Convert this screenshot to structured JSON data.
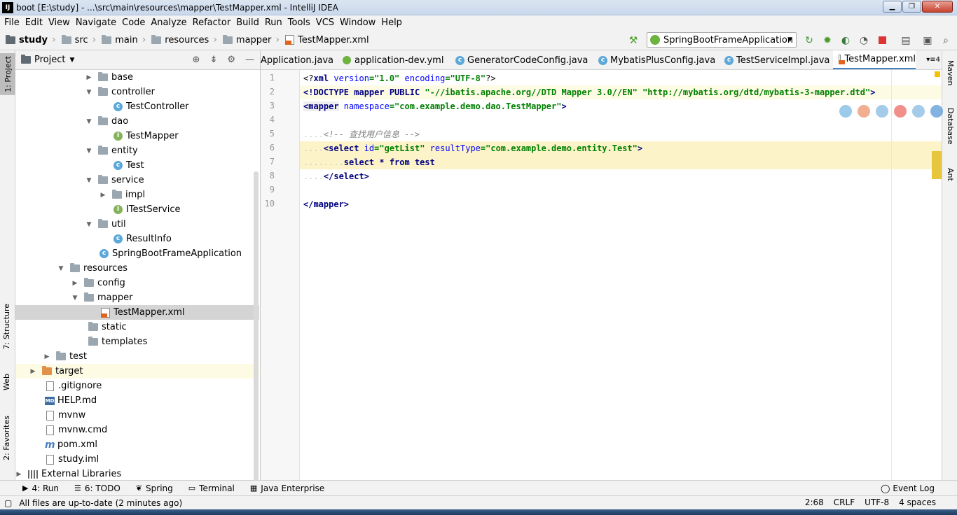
{
  "window": {
    "title": "boot [E:\\study] - ...\\src\\main\\resources\\mapper\\TestMapper.xml - IntelliJ IDEA",
    "app_icon": "IJ"
  },
  "menu": [
    "File",
    "Edit",
    "View",
    "Navigate",
    "Code",
    "Analyze",
    "Refactor",
    "Build",
    "Run",
    "Tools",
    "VCS",
    "Window",
    "Help"
  ],
  "breadcrumbs": [
    "study",
    "src",
    "main",
    "resources",
    "mapper",
    "TestMapper.xml"
  ],
  "run_config": "SpringBootFrameApplication",
  "left_stripe": [
    "1: Project",
    "7: Structure",
    "Web",
    "2: Favorites"
  ],
  "right_stripe": [
    "Maven",
    "Database",
    "Ant"
  ],
  "project_panel": {
    "title": "Project",
    "tree": [
      {
        "label": "base",
        "type": "folder",
        "chev": "right"
      },
      {
        "label": "controller",
        "type": "folder",
        "chev": "down"
      },
      {
        "label": "TestController",
        "type": "class",
        "chev": ""
      },
      {
        "label": "dao",
        "type": "folder",
        "chev": "down"
      },
      {
        "label": "TestMapper",
        "type": "interface",
        "chev": ""
      },
      {
        "label": "entity",
        "type": "folder",
        "chev": "down"
      },
      {
        "label": "Test",
        "type": "class",
        "chev": ""
      },
      {
        "label": "service",
        "type": "folder",
        "chev": "down"
      },
      {
        "label": "impl",
        "type": "folder",
        "chev": "right"
      },
      {
        "label": "ITestService",
        "type": "interface",
        "chev": ""
      },
      {
        "label": "util",
        "type": "folder",
        "chev": "down"
      },
      {
        "label": "ResultInfo",
        "type": "class",
        "chev": ""
      },
      {
        "label": "SpringBootFrameApplication",
        "type": "class",
        "chev": ""
      },
      {
        "label": "resources",
        "type": "folder",
        "chev": "down"
      },
      {
        "label": "config",
        "type": "folder",
        "chev": "right"
      },
      {
        "label": "mapper",
        "type": "folder",
        "chev": "down"
      },
      {
        "label": "TestMapper.xml",
        "type": "xml",
        "chev": ""
      },
      {
        "label": "static",
        "type": "folder",
        "chev": ""
      },
      {
        "label": "templates",
        "type": "folder",
        "chev": ""
      },
      {
        "label": "test",
        "type": "folder",
        "chev": "right"
      },
      {
        "label": "target",
        "type": "folder-orange",
        "chev": "right"
      },
      {
        "label": ".gitignore",
        "type": "file",
        "chev": ""
      },
      {
        "label": "HELP.md",
        "type": "md",
        "chev": ""
      },
      {
        "label": "mvnw",
        "type": "file",
        "chev": ""
      },
      {
        "label": "mvnw.cmd",
        "type": "file",
        "chev": ""
      },
      {
        "label": "pom.xml",
        "type": "maven",
        "chev": ""
      },
      {
        "label": "study.iml",
        "type": "file",
        "chev": ""
      },
      {
        "label": "External Libraries",
        "type": "lib",
        "chev": "right"
      }
    ]
  },
  "editor_tabs": [
    {
      "label": "Application.java",
      "icon": "none"
    },
    {
      "label": "application-dev.yml",
      "icon": "spring"
    },
    {
      "label": "GeneratorCodeConfig.java",
      "icon": "class"
    },
    {
      "label": "MybatisPlusConfig.java",
      "icon": "class"
    },
    {
      "label": "TestServiceImpl.java",
      "icon": "class"
    },
    {
      "label": "TestMapper.xml",
      "icon": "xml"
    }
  ],
  "tab_overflow": "4",
  "code_lines": [
    "1",
    "2",
    "3",
    "4",
    "5",
    "6",
    "7",
    "8",
    "9",
    "10"
  ],
  "code": {
    "l1a": "<?",
    "l1b": "xml",
    "l1c": " version",
    "l1d": "=\"1.0\"",
    "l1e": " encoding",
    "l1f": "=\"UTF-8\"",
    "l1g": "?>",
    "l2a": "<!DOCTYPE ",
    "l2b": "mapper",
    "l2c": " PUBLIC ",
    "l2d": "\"-//ibatis.apache.org//DTD Mapper 3.0//EN\"",
    "l2e": " ",
    "l2f": "\"http://mybatis.org/dtd/mybatis-3-mapper.dtd\"",
    "l2g": ">",
    "l3a": "<mapper",
    "l3b": " namespace",
    "l3c": "=\"com.example.demo.dao.TestMapper\"",
    "l3d": ">",
    "l5a": "....",
    "l5b": "<!-- 查找用户信息 -->",
    "l6a": "....",
    "l6b": "<select",
    "l6c": " id",
    "l6d": "=\"getList\"",
    "l6e": " resultType",
    "l6f": "=\"com.example.demo.entity.Test\"",
    "l6g": ">",
    "l7a": "........",
    "l7b": "select * from test",
    "l8a": "....",
    "l8b": "</select>",
    "l10": "</mapper>"
  },
  "bottom_tabs": [
    {
      "label": "4: Run",
      "icon": "▶"
    },
    {
      "label": "6: TODO",
      "icon": "☰"
    },
    {
      "label": "Spring",
      "icon": "❦"
    },
    {
      "label": "Terminal",
      "icon": "▭"
    },
    {
      "label": "Java Enterprise",
      "icon": "▦"
    }
  ],
  "event_log": "Event Log",
  "status": {
    "message": "All files are up-to-date (2 minutes ago)",
    "position": "2:68",
    "line_sep": "CRLF",
    "encoding": "UTF-8",
    "indent": "4 spaces"
  }
}
